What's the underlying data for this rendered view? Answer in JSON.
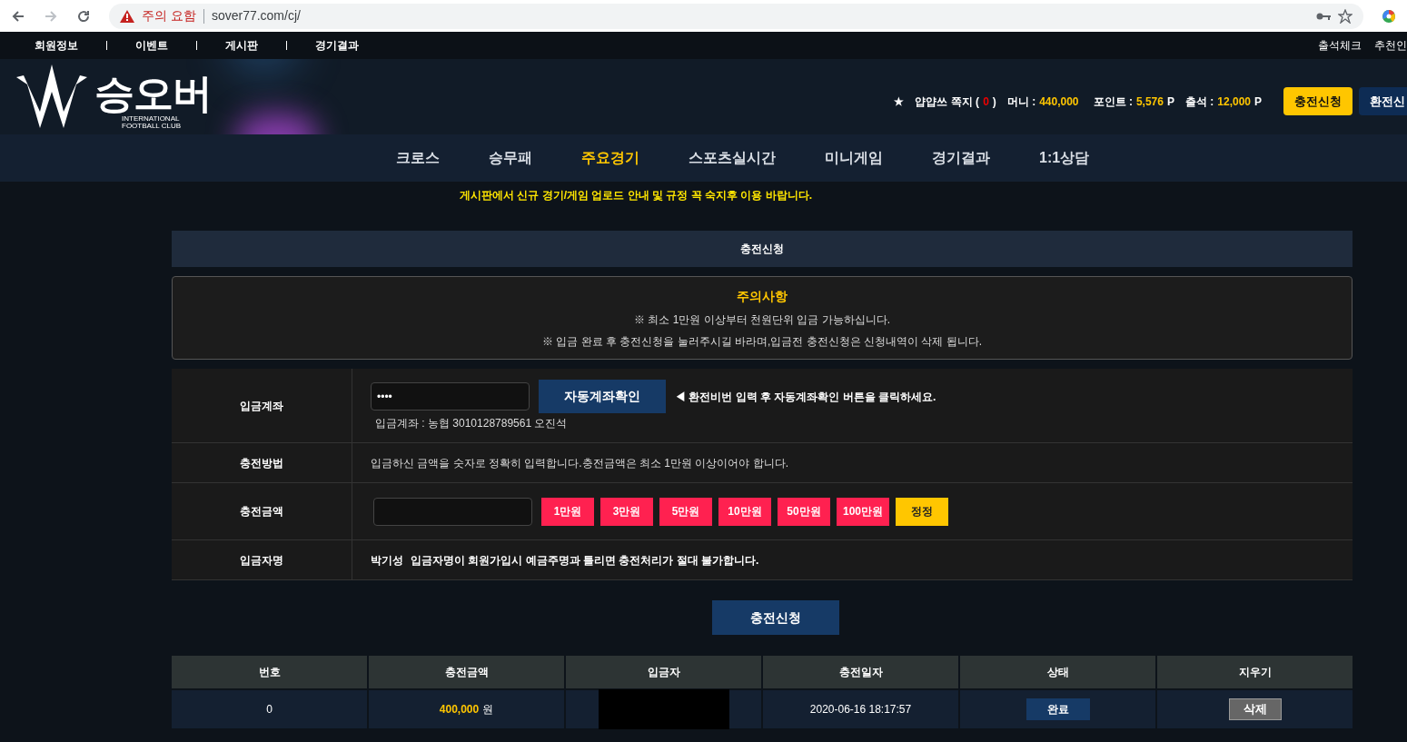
{
  "browser": {
    "warning": "주의 요함",
    "url": "sover77.com/cj/"
  },
  "top_links": [
    "회원정보",
    "이벤트",
    "게시판",
    "경기결과"
  ],
  "top_right_links": [
    "출석체크",
    "추천인"
  ],
  "logo": {
    "title": "승오버",
    "subtitle_1": "INTERNATIONAL",
    "subtitle_2": "FOOTBALL CLUB"
  },
  "user_info": {
    "star": "★",
    "name": "얍얍쓰",
    "messages_label": "쪽지 (",
    "messages_count": "0",
    "messages_close": ")",
    "money_label": "머니 :",
    "money": "440,000",
    "points_label": "포인트 :",
    "points": "5,576",
    "points_unit": "P",
    "attendance_label": "출석 :",
    "attendance": "12,000",
    "attendance_unit": "P"
  },
  "header_buttons": [
    {
      "label": "충전신청",
      "kind": "primary"
    },
    {
      "label": "환전신",
      "kind": "secondary"
    }
  ],
  "main_nav": [
    {
      "label": "크로스",
      "selected": false
    },
    {
      "label": "승무패",
      "selected": false
    },
    {
      "label": "주요경기",
      "selected": true
    },
    {
      "label": "스포츠실시간",
      "selected": false
    },
    {
      "label": "미니게임",
      "selected": false
    },
    {
      "label": "경기결과",
      "selected": false
    },
    {
      "label": "1:1상담",
      "selected": false
    }
  ],
  "notice": "게시판에서 신규 경기/게임 업로드 안내 및 규정 꼭 숙지후 이용 바랍니다.",
  "section_title": "충전신청",
  "caution": {
    "title": "주의사항",
    "lines": [
      "※ 최소 1만원 이상부터 천원단위 입금 가능하십니다.",
      "※ 입금 완료 후 충전신청을 눌러주시길 바라며,입금전 충전신청은 신청내역이 삭제 됩니다."
    ]
  },
  "form": {
    "account": {
      "label": "입금계좌",
      "password_value": "••••",
      "check_button": "자동계좌확인",
      "hint": "◀ 환전비번 입력 후 자동계좌확인 버튼을 클릭하세요.",
      "account_info": "입금계좌 : 농협 3010128789561 오진석"
    },
    "method": {
      "label": "충전방법",
      "text": "입금하신 금액을 숫자로 정확히 입력합니다.충전금액은 최소 1만원 이상이어야 합니다."
    },
    "amount": {
      "label": "충전금액",
      "buttons": [
        {
          "label": "1만원",
          "kind": "add"
        },
        {
          "label": "3만원",
          "kind": "add"
        },
        {
          "label": "5만원",
          "kind": "add"
        },
        {
          "label": "10만원",
          "kind": "add"
        },
        {
          "label": "50만원",
          "kind": "add"
        },
        {
          "label": "100만원",
          "kind": "add"
        },
        {
          "label": "정정",
          "kind": "reset"
        }
      ]
    },
    "depositor": {
      "label": "입금자명",
      "name": "박기성",
      "text": "입금자명이 회원가입시 예금주명과 틀리면 충전처리가 절대 불가합니다."
    }
  },
  "submit_button": "충전신청",
  "table": {
    "columns": [
      "번호",
      "충전금액",
      "입금자",
      "충전일자",
      "상태",
      "지우기"
    ],
    "rows": [
      {
        "number": "0",
        "amount": "400,000",
        "amount_unit": "원",
        "depositor_redacted": true,
        "date": "2020-06-16 18:17:57",
        "status": "완료",
        "delete": "삭제"
      }
    ]
  }
}
